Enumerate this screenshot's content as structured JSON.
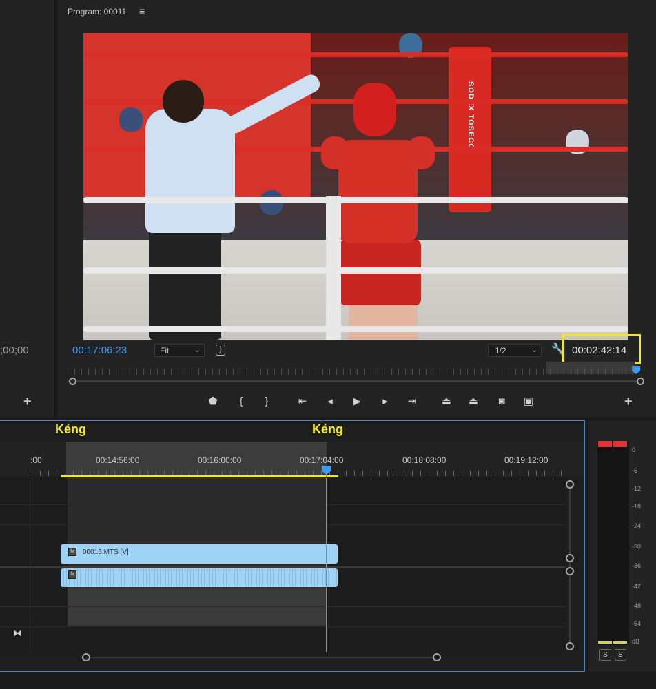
{
  "source_panel": {
    "timecode": ";00;00",
    "add_button": "+"
  },
  "program_monitor": {
    "title": "Program: 00011",
    "menu_icon": "hamburger-icon",
    "video_text": "SODEX TOSECO",
    "current_timecode": "00:17:06:23",
    "zoom_select": "Fit",
    "resolution_select": "1/2",
    "duration": "00:02:42:14",
    "highlight_color": "#f4ea1b",
    "playhead_color": "#3f9bf2",
    "transport_buttons": [
      {
        "name": "add-marker-icon",
        "glyph": "⬟"
      },
      {
        "name": "mark-in-icon",
        "glyph": "{"
      },
      {
        "name": "mark-out-icon",
        "glyph": "}"
      },
      {
        "name": "go-to-in-icon",
        "glyph": "|←"
      },
      {
        "name": "step-back-icon",
        "glyph": "◂|"
      },
      {
        "name": "play-icon",
        "glyph": "▶"
      },
      {
        "name": "step-forward-icon",
        "glyph": "|▸"
      },
      {
        "name": "go-to-out-icon",
        "glyph": "→|"
      },
      {
        "name": "lift-icon",
        "glyph": "⏏"
      },
      {
        "name": "extract-icon",
        "glyph": "⏏"
      },
      {
        "name": "export-frame-icon",
        "glyph": "◙"
      },
      {
        "name": "comparison-view-icon",
        "glyph": "▣"
      }
    ],
    "add_button": "+"
  },
  "timeline": {
    "annotations": [
      "Kẻng",
      "Kẻng"
    ],
    "ruler_labels": [
      ":00",
      "00:14:56:00",
      "00:16:00:00",
      "00:17:04:00",
      "00:18:08:00",
      "00:19:12:00"
    ],
    "video_clip": {
      "label": "00016.MTS [V]",
      "fx": "fx"
    },
    "audio_clip": {
      "fx": "fx"
    },
    "clip_color": "#9fd3f6"
  },
  "audio_meter": {
    "db_scale": [
      "0",
      "-6",
      "-12",
      "-18",
      "-24",
      "-30",
      "-36",
      "-42",
      "-48",
      "-54",
      "dB"
    ],
    "solo_buttons": [
      "S",
      "S"
    ],
    "peak_color": "#e03333"
  }
}
